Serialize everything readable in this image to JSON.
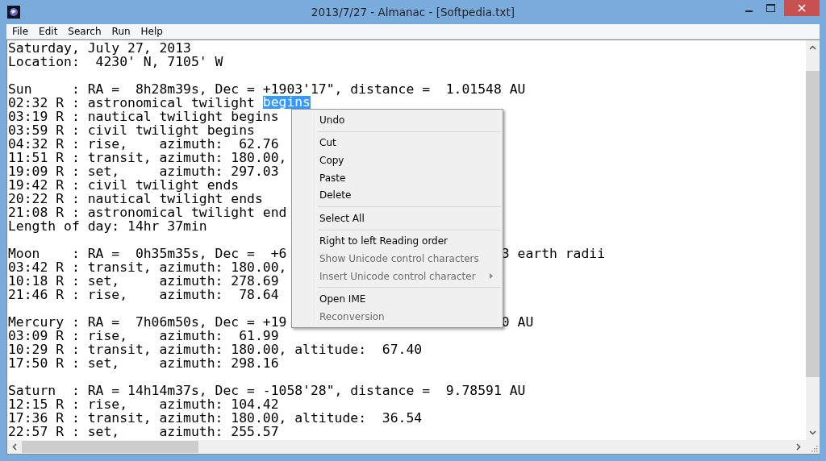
{
  "window": {
    "title": "2013/7/27 - Almanac - [Softpedia.txt]"
  },
  "menu_bar": [
    "File",
    "Edit",
    "Search",
    "Run",
    "Help"
  ],
  "document": {
    "blocks": [
      {
        "lines": [
          {
            "parts": [
              {
                "text": "Saturday, July 27, 2013",
                "selected": false
              }
            ]
          },
          {
            "parts": [
              {
                "text": "Location:  4230' N, 7105' W",
                "selected": false
              }
            ]
          }
        ]
      },
      {
        "lines": [
          {
            "parts": [
              {
                "text": "Sun     : RA =  8h28m39s, Dec = +1903'17\", distance =  1.01548 AU",
                "selected": false
              }
            ]
          },
          {
            "parts": [
              {
                "text": "02:32 R : astronomical twilight ",
                "selected": false
              },
              {
                "text": "begins",
                "selected": true
              }
            ]
          },
          {
            "parts": [
              {
                "text": "03:19 R : nautical twilight begins",
                "selected": false
              }
            ]
          },
          {
            "parts": [
              {
                "text": "03:59 R : civil twilight begins",
                "selected": false
              }
            ]
          },
          {
            "parts": [
              {
                "text": "04:32 R : rise,    azimuth:  62.76",
                "selected": false
              }
            ]
          },
          {
            "parts": [
              {
                "text": "11:51 R : transit, azimuth: 180.00,",
                "selected": false
              }
            ]
          },
          {
            "parts": [
              {
                "text": "19:09 R : set,     azimuth: 297.03",
                "selected": false
              }
            ]
          },
          {
            "parts": [
              {
                "text": "19:42 R : civil twilight ends",
                "selected": false
              }
            ]
          },
          {
            "parts": [
              {
                "text": "20:22 R : nautical twilight ends",
                "selected": false
              }
            ]
          },
          {
            "parts": [
              {
                "text": "21:08 R : astronomical twilight end",
                "selected": false
              }
            ]
          },
          {
            "parts": [
              {
                "text": "Length of day: 14hr 37min",
                "selected": false
              }
            ]
          }
        ]
      },
      {
        "lines": [
          {
            "parts": [
              {
                "text": "Moon    : RA =  0h35m35s, Dec =  +6",
                "selected": false
              }
            ],
            "tail": "3 earth radii"
          },
          {
            "parts": [
              {
                "text": "03:42 R : transit, azimuth: 180.00,",
                "selected": false
              }
            ]
          },
          {
            "parts": [
              {
                "text": "10:18 R : set,     azimuth: 278.69",
                "selected": false
              }
            ]
          },
          {
            "parts": [
              {
                "text": "21:46 R : rise,    azimuth:  78.64",
                "selected": false
              }
            ]
          }
        ]
      },
      {
        "lines": [
          {
            "parts": [
              {
                "text": "Mercury : RA =  7h06m50s, Dec = +19",
                "selected": false
              }
            ],
            "tail": "0 AU"
          },
          {
            "parts": [
              {
                "text": "03:09 R : rise,    azimuth:  61.99",
                "selected": false
              }
            ]
          },
          {
            "parts": [
              {
                "text": "10:29 R : transit, azimuth: 180.00, altitude:  67.40",
                "selected": false
              }
            ]
          },
          {
            "parts": [
              {
                "text": "17:50 R : set,     azimuth: 298.16",
                "selected": false
              }
            ]
          }
        ]
      },
      {
        "lines": [
          {
            "parts": [
              {
                "text": "Saturn  : RA = 14h14m37s, Dec = -1058'28\", distance =  9.78591 AU",
                "selected": false
              }
            ]
          },
          {
            "parts": [
              {
                "text": "12:15 R : rise,    azimuth: 104.42",
                "selected": false
              }
            ]
          },
          {
            "parts": [
              {
                "text": "17:36 R : transit, azimuth: 180.00, altitude:  36.54",
                "selected": false
              }
            ]
          },
          {
            "parts": [
              {
                "text": "22:57 R : set,     azimuth: 255.57",
                "selected": false
              }
            ]
          }
        ]
      }
    ]
  },
  "context_menu": {
    "items": [
      {
        "kind": "item",
        "label": "Undo",
        "disabled": false,
        "submenu": false
      },
      {
        "kind": "separator"
      },
      {
        "kind": "item",
        "label": "Cut",
        "disabled": false,
        "submenu": false
      },
      {
        "kind": "item",
        "label": "Copy",
        "disabled": false,
        "submenu": false
      },
      {
        "kind": "item",
        "label": "Paste",
        "disabled": false,
        "submenu": false
      },
      {
        "kind": "item",
        "label": "Delete",
        "disabled": false,
        "submenu": false
      },
      {
        "kind": "separator"
      },
      {
        "kind": "item",
        "label": "Select All",
        "disabled": false,
        "submenu": false
      },
      {
        "kind": "separator"
      },
      {
        "kind": "item",
        "label": "Right to left Reading order",
        "disabled": false,
        "submenu": false
      },
      {
        "kind": "item",
        "label": "Show Unicode control characters",
        "disabled": true,
        "submenu": false
      },
      {
        "kind": "item",
        "label": "Insert Unicode control character",
        "disabled": true,
        "submenu": true
      },
      {
        "kind": "separator"
      },
      {
        "kind": "item",
        "label": "Open IME",
        "disabled": false,
        "submenu": false
      },
      {
        "kind": "item",
        "label": "Reconversion",
        "disabled": true,
        "submenu": false
      }
    ]
  }
}
